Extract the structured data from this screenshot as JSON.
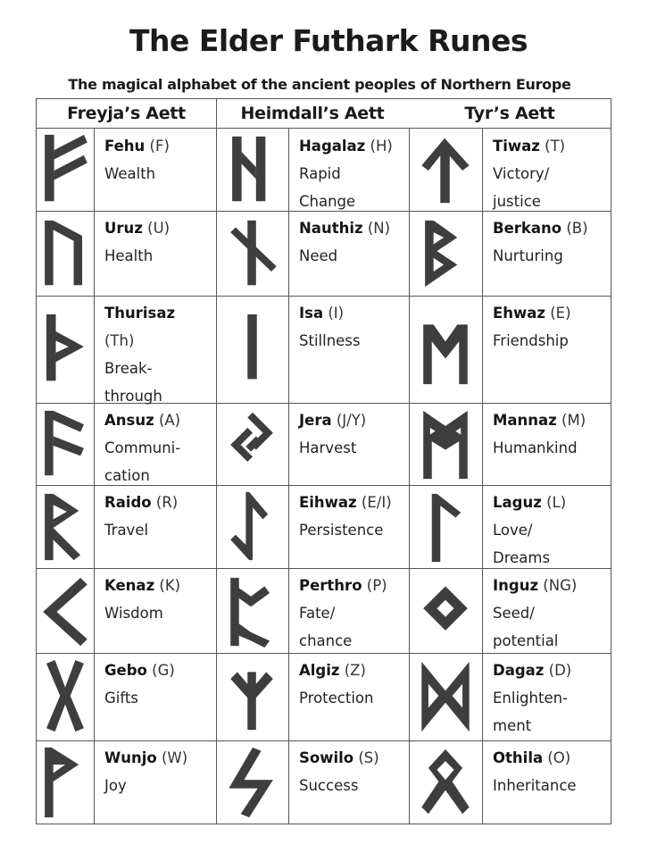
{
  "title": "The Elder Futhark Runes",
  "subtitle": "The magical alphabet of the ancient peoples of Northern Europe",
  "aetts": [
    {
      "name": "Freyja’s Aett",
      "runes": [
        {
          "icon": "fehu-rune-icon",
          "name": "Fehu",
          "letter": "(F)",
          "meaning": "Wealth"
        },
        {
          "icon": "uruz-rune-icon",
          "name": "Uruz",
          "letter": "(U)",
          "meaning": "Health"
        },
        {
          "icon": "thurisaz-rune-icon",
          "name": "Thurisaz",
          "letter": "(Th)",
          "meaning": "Break-\nthrough",
          "letter_newline": true
        },
        {
          "icon": "ansuz-rune-icon",
          "name": "Ansuz",
          "letter": "(A)",
          "meaning": "Communi-\ncation"
        },
        {
          "icon": "raido-rune-icon",
          "name": "Raido",
          "letter": "(R)",
          "meaning": "Travel"
        },
        {
          "icon": "kenaz-rune-icon",
          "name": "Kenaz",
          "letter": "(K)",
          "meaning": "Wisdom"
        },
        {
          "icon": "gebo-rune-icon",
          "name": "Gebo",
          "letter": "(G)",
          "meaning": "Gifts"
        },
        {
          "icon": "wunjo-rune-icon",
          "name": "Wunjo",
          "letter": "(W)",
          "meaning": "Joy"
        }
      ]
    },
    {
      "name": "Heimdall’s Aett",
      "runes": [
        {
          "icon": "hagalaz-rune-icon",
          "name": "Hagalaz",
          "letter": "(H)",
          "meaning": "Rapid\nChange"
        },
        {
          "icon": "nauthiz-rune-icon",
          "name": "Nauthiz",
          "letter": " (N)",
          "meaning": "Need"
        },
        {
          "icon": "isa-rune-icon",
          "name": "Isa",
          "letter": "(I)",
          "meaning": "Stillness"
        },
        {
          "icon": "jera-rune-icon",
          "name": "Jera",
          "letter": "(J/Y)",
          "meaning": "Harvest"
        },
        {
          "icon": "eihwaz-rune-icon",
          "name": "Eihwaz",
          "letter": "(E/I)",
          "meaning": "Persistence"
        },
        {
          "icon": "perthro-rune-icon",
          "name": "Perthro",
          "letter": "(P)",
          "meaning": "Fate/\nchance"
        },
        {
          "icon": "algiz-rune-icon",
          "name": "Algiz",
          "letter": "(Z)",
          "meaning": "Protection"
        },
        {
          "icon": "sowilo-rune-icon",
          "name": "Sowilo",
          "letter": "(S)",
          "meaning": "Success"
        }
      ]
    },
    {
      "name": "Tyr’s Aett",
      "runes": [
        {
          "icon": "tiwaz-rune-icon",
          "name": "Tiwaz",
          "letter": "(T)",
          "meaning": "Victory/\njustice"
        },
        {
          "icon": "berkano-rune-icon",
          "name": "Berkano",
          "letter": "(B)",
          "meaning": "Nurturing"
        },
        {
          "icon": "ehwaz-rune-icon",
          "name": "Ehwaz",
          "letter": "(E)",
          "meaning": "Friendship"
        },
        {
          "icon": "mannaz-rune-icon",
          "name": "Mannaz",
          "letter": "(M)",
          "meaning": "Humankind"
        },
        {
          "icon": "laguz-rune-icon",
          "name": "Laguz",
          "letter": "(L)",
          "meaning": "Love/\nDreams"
        },
        {
          "icon": "inguz-rune-icon",
          "name": "Inguz",
          "letter": "(NG)",
          "meaning": "Seed/\npotential"
        },
        {
          "icon": "dagaz-rune-icon",
          "name": "Dagaz",
          "letter": "(D)",
          "meaning": "Enlighten-\nment"
        },
        {
          "icon": "othila-rune-icon",
          "name": "Othila",
          "letter": "(O)",
          "meaning": "Inheritance"
        }
      ]
    }
  ]
}
